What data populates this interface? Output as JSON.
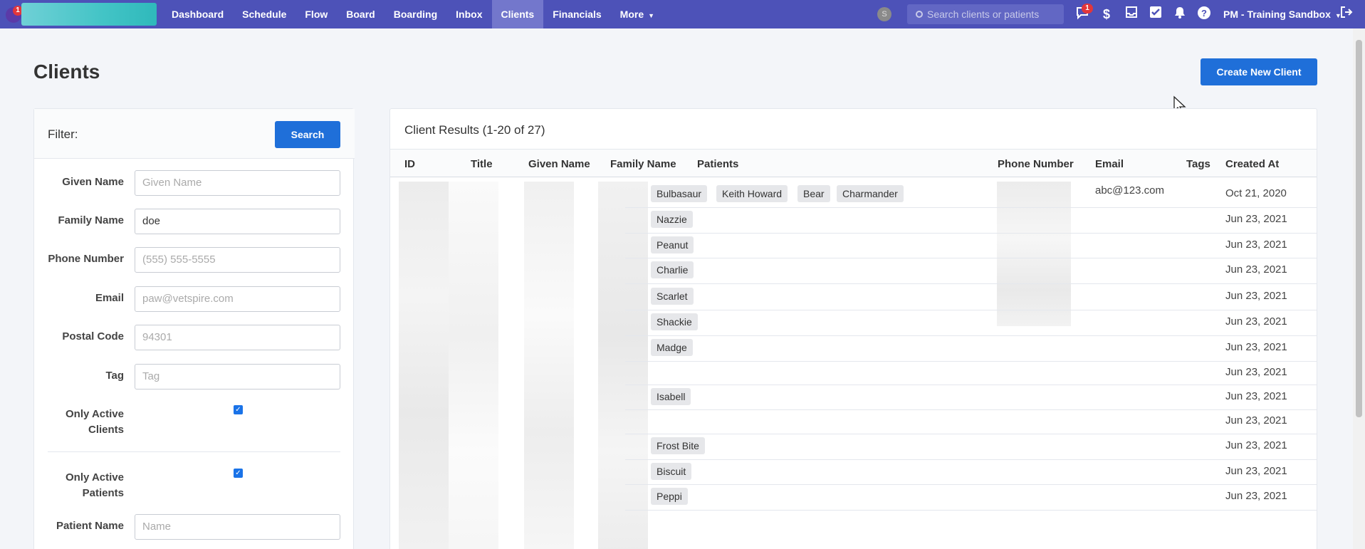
{
  "nav": {
    "notification_badge": "1",
    "links": [
      {
        "label": "Dashboard"
      },
      {
        "label": "Schedule"
      },
      {
        "label": "Flow"
      },
      {
        "label": "Board"
      },
      {
        "label": "Boarding"
      },
      {
        "label": "Inbox"
      },
      {
        "label": "Clients"
      },
      {
        "label": "Financials"
      },
      {
        "label": "More"
      }
    ],
    "active": "Clients",
    "avatar_letter": "S",
    "search_placeholder": "Search clients or patients",
    "messages_badge": "1",
    "org_name": "PM - Training Sandbox",
    "icons": [
      "messages-icon",
      "dollar-icon",
      "inbox-tray-icon",
      "checkbox-icon",
      "bell-icon",
      "help-icon",
      "logout-icon"
    ],
    "colors": {
      "bar": "#4d52b8",
      "active": "#7377cc",
      "accent": "#1f6fd9"
    }
  },
  "page": {
    "title": "Clients",
    "create_button": "Create New Client"
  },
  "filter": {
    "title": "Filter:",
    "search_button": "Search",
    "fields": {
      "given_name": {
        "label": "Given Name",
        "placeholder": "Given Name",
        "value": ""
      },
      "family_name": {
        "label": "Family Name",
        "placeholder": "",
        "value": "doe"
      },
      "phone": {
        "label": "Phone Number",
        "placeholder": "(555) 555-5555",
        "value": ""
      },
      "email": {
        "label": "Email",
        "placeholder": "paw@vetspire.com",
        "value": ""
      },
      "postal": {
        "label": "Postal Code",
        "placeholder": "94301",
        "value": ""
      },
      "tag": {
        "label": "Tag",
        "placeholder": "Tag",
        "value": ""
      },
      "active_clients": {
        "label_line1": "Only Active",
        "label_line2": "Clients",
        "checked": true
      },
      "active_patients": {
        "label_line1": "Only Active",
        "label_line2": "Patients",
        "checked": true
      },
      "patient_name": {
        "label": "Patient Name",
        "placeholder": "Name",
        "value": ""
      }
    }
  },
  "results": {
    "title": "Client Results (1-20 of 27)",
    "columns": [
      "ID",
      "Title",
      "Given Name",
      "Family Name",
      "Patients",
      "Phone Number",
      "Email",
      "Tags",
      "Created At"
    ],
    "rows": [
      {
        "patients": [
          "Bulbasaur",
          "Keith Howard",
          "Bear",
          "Charmander"
        ],
        "email": "abc@123.com",
        "created": "Oct 21, 2020"
      },
      {
        "patients": [
          "Nazzie"
        ],
        "email": "",
        "created": "Jun 23, 2021"
      },
      {
        "patients": [
          "Peanut"
        ],
        "email": "",
        "created": "Jun 23, 2021"
      },
      {
        "patients": [
          "Charlie"
        ],
        "email": "",
        "created": "Jun 23, 2021"
      },
      {
        "patients": [
          "Scarlet"
        ],
        "email": "",
        "created": "Jun 23, 2021"
      },
      {
        "patients": [
          "Shackie"
        ],
        "email": "",
        "created": "Jun 23, 2021"
      },
      {
        "patients": [
          "Madge"
        ],
        "email": "",
        "created": "Jun 23, 2021"
      },
      {
        "patients": [],
        "email": "",
        "created": "Jun 23, 2021"
      },
      {
        "patients": [
          "Isabell"
        ],
        "email": "",
        "created": "Jun 23, 2021"
      },
      {
        "patients": [],
        "email": "",
        "created": "Jun 23, 2021"
      },
      {
        "patients": [
          "Frost Bite"
        ],
        "email": "",
        "created": "Jun 23, 2021"
      },
      {
        "patients": [
          "Biscuit"
        ],
        "email": "",
        "created": "Jun 23, 2021"
      },
      {
        "patients": [
          "Peppi"
        ],
        "email": "",
        "created": "Jun 23, 2021"
      }
    ]
  }
}
